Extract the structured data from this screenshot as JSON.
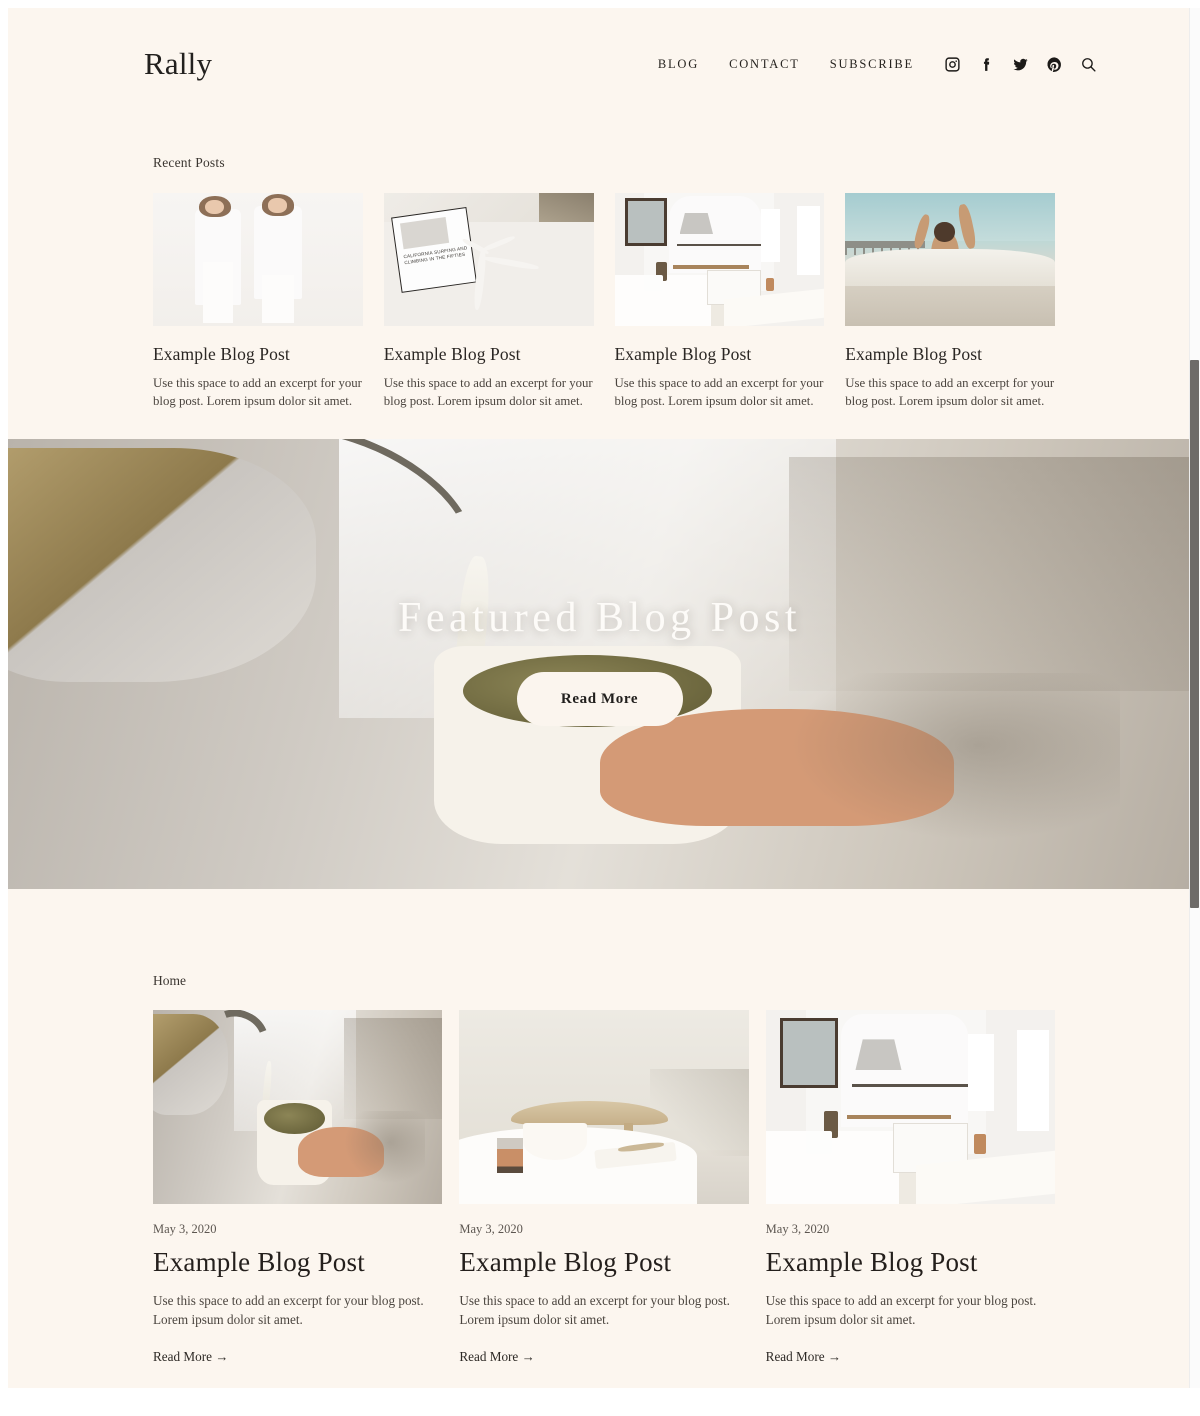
{
  "site": {
    "brand": "Rally",
    "nav": [
      {
        "label": "BLOG"
      },
      {
        "label": "CONTACT"
      },
      {
        "label": "SUBSCRIBE"
      }
    ],
    "social": [
      {
        "name": "instagram-icon"
      },
      {
        "name": "facebook-icon"
      },
      {
        "name": "twitter-icon"
      },
      {
        "name": "pinterest-icon"
      }
    ],
    "search_icon": "search-icon"
  },
  "recent": {
    "eyebrow": "Recent Posts",
    "posts": [
      {
        "title": "Example Blog Post",
        "excerpt": "Use this space to add an excerpt for your blog post. Lorem ipsum dolor sit amet.",
        "image_alt": "two-women-in-white-outfits"
      },
      {
        "title": "Example Blog Post",
        "excerpt": "Use this space to add an excerpt for your blog post. Lorem ipsum dolor sit amet.",
        "image_alt": "book-and-antler-on-marble",
        "book_title": "CALIFORNIA SURFING AND CLIMBING IN THE FIFTIES"
      },
      {
        "title": "Example Blog Post",
        "excerpt": "Use this space to add an excerpt for your blog post. Lorem ipsum dolor sit amet.",
        "image_alt": "white-kitchen-interior"
      },
      {
        "title": "Example Blog Post",
        "excerpt": "Use this space to add an excerpt for your blog post. Lorem ipsum dolor sit amet.",
        "image_alt": "person-splashing-in-ocean-waves"
      }
    ]
  },
  "featured": {
    "title": "Featured Blog Post",
    "button_label": "Read More",
    "image_alt": "hand-holding-mug-while-tea-is-poured"
  },
  "home": {
    "eyebrow": "Home",
    "posts": [
      {
        "date": "May 3, 2020",
        "title": "Example Blog Post",
        "excerpt": "Use this space to add an excerpt for your blog post. Lorem ipsum dolor sit amet.",
        "read_more": "Read More →",
        "image_alt": "hand-holding-mug-while-tea-is-poured"
      },
      {
        "date": "May 3, 2020",
        "title": "Example Blog Post",
        "excerpt": "Use this space to add an excerpt for your blog post. Lorem ipsum dolor sit amet.",
        "read_more": "Read More →",
        "image_alt": "bowl-and-cup-on-round-table"
      },
      {
        "date": "May 3, 2020",
        "title": "Example Blog Post",
        "excerpt": "Use this space to add an excerpt for your blog post. Lorem ipsum dolor sit amet.",
        "read_more": "Read More →",
        "image_alt": "white-kitchen-interior"
      }
    ]
  },
  "theme": {
    "page_background": "#fcf6ef",
    "text_color": "#2b2724",
    "button_background": "#fbf5ee",
    "banner_overlay_text": "#fdfbf8"
  }
}
